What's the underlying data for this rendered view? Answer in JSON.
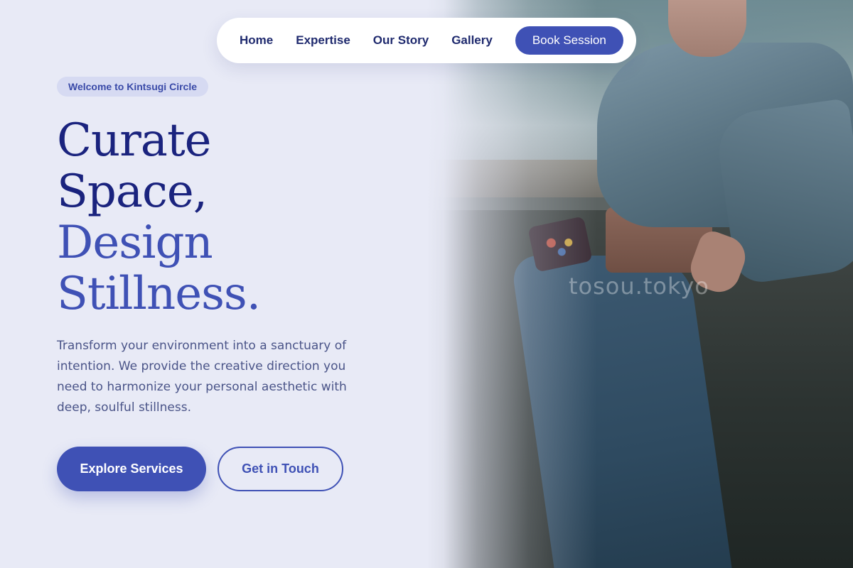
{
  "nav": {
    "links": [
      "Home",
      "Expertise",
      "Our Story",
      "Gallery"
    ],
    "cta": "Book Session"
  },
  "hero": {
    "badge": "Welcome to Kintsugi Circle",
    "headline": {
      "line1": "Curate",
      "line2": "Space,",
      "line3": "Design",
      "line4": "Stillness."
    },
    "description": "Transform your environment into a sanctuary of intention. We provide the creative direction you need to harmonize your personal aesthetic with deep, soulful stillness.",
    "primary_button": "Explore Services",
    "secondary_button": "Get in Touch"
  },
  "photo": {
    "watermark": "tosou.tokyo"
  },
  "colors": {
    "background": "#e8eaf6",
    "primary": "#3f51b5",
    "heading_dark": "#1a237e",
    "badge_bg": "#d6daf2"
  }
}
